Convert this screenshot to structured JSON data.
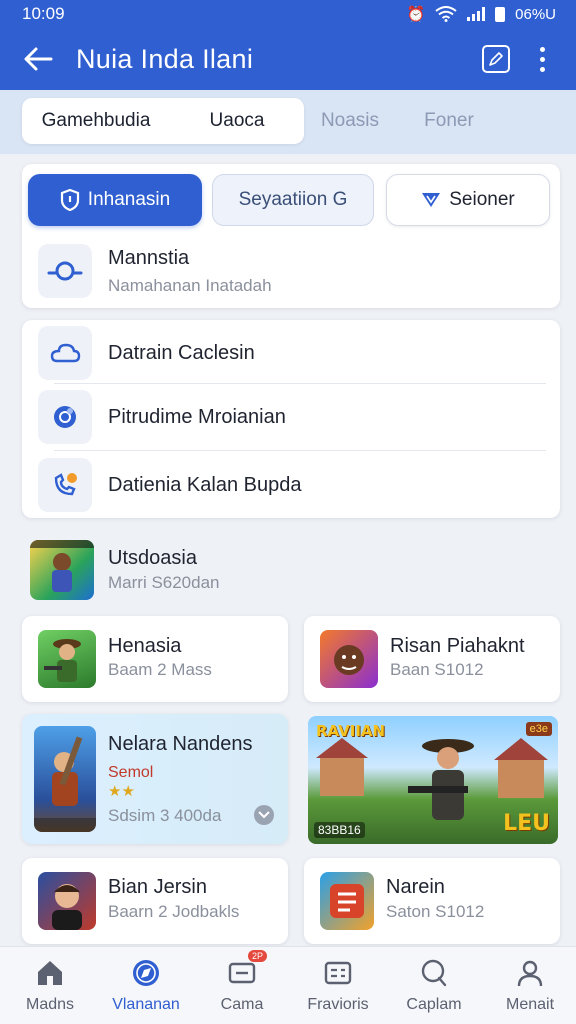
{
  "status_bar": {
    "time": "10:09",
    "battery": "06%U"
  },
  "app_bar": {
    "title": "Nuia  Inda Ilani"
  },
  "tabs": [
    {
      "label": "Gamehbudia",
      "active": true
    },
    {
      "label": "Uaoca",
      "active": true
    },
    {
      "label": "Noasis",
      "active": false
    },
    {
      "label": "Foner",
      "active": false
    }
  ],
  "chips": {
    "primary": "Inhanasin",
    "secondary": "Seyaatiion G",
    "outline": "Seioner"
  },
  "first_card": {
    "title": "Mannstia",
    "subtitle": "Namahanan Inatadah"
  },
  "list_card": {
    "items": [
      {
        "label": "Datrain Caclesin",
        "icon": "cloud-icon"
      },
      {
        "label": "Pitrudime Mroianian",
        "icon": "circle-icon"
      },
      {
        "label": "Datienia Kalan Bupda",
        "icon": "phone-icon"
      }
    ]
  },
  "featured": {
    "title": "Utsdoasia",
    "subtitle": "Marri S620dan"
  },
  "games": [
    {
      "title": "Henasia",
      "subtitle": "Baam 2 Mass"
    },
    {
      "title": "Risan Piahaknt",
      "subtitle": "Baan S1012"
    },
    {
      "title": "Nelara Nandens",
      "tag": "Semol",
      "stars": "★★",
      "subtitle": "Sdsim 3 400da"
    },
    {
      "banner_title": "RAVIIAN",
      "banner_badge": "e3e",
      "banner_corner": "LEU",
      "banner_bottom": "83BB16"
    },
    {
      "title": "Bian Jersin",
      "subtitle": "Baarn 2 Jodbakls"
    },
    {
      "title": "Narein",
      "subtitle": "Saton S1012"
    }
  ],
  "bottom_nav": [
    {
      "label": "Madns",
      "icon": "home-icon",
      "active": false
    },
    {
      "label": "Vlananan",
      "icon": "compass-icon",
      "active": true
    },
    {
      "label": "Cama",
      "icon": "message-icon",
      "active": false,
      "badge": "2P"
    },
    {
      "label": "Fravioris",
      "icon": "list-icon",
      "active": false
    },
    {
      "label": "Caplam",
      "icon": "chat-icon",
      "active": false
    },
    {
      "label": "Menait",
      "icon": "person-icon",
      "active": false
    }
  ],
  "colors": {
    "primary": "#2f5fd0",
    "tab_bg": "#d9e4f5",
    "page_bg": "#eef1f6"
  }
}
